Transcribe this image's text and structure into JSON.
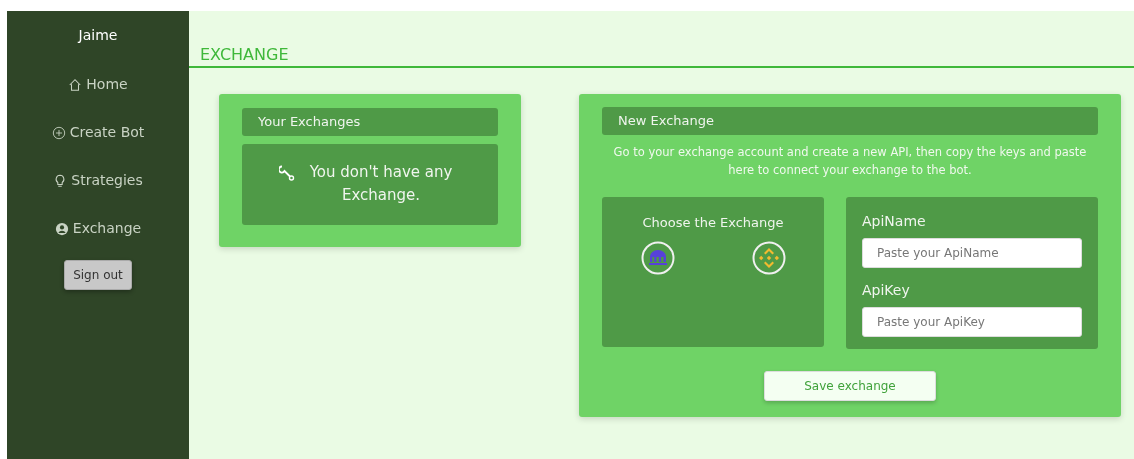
{
  "sidebar": {
    "user": "Jaime",
    "items": [
      {
        "label": "Home"
      },
      {
        "label": "Create Bot"
      },
      {
        "label": "Strategies"
      },
      {
        "label": "Exchange"
      }
    ],
    "sign_out": "Sign out"
  },
  "page_title": "EXCHANGE",
  "your_exchanges": {
    "title": "Your Exchanges",
    "empty_message": "You don't have any Exchange."
  },
  "new_exchange": {
    "title": "New Exchange",
    "instructions": "Go to your exchange account and create a new API, then copy the keys and paste here to connect your exchange to the bot.",
    "choose_title": "Choose the Exchange",
    "exchanges": [
      {
        "kind": "kraken"
      },
      {
        "kind": "binance"
      }
    ],
    "fields": [
      {
        "label": "ApiName",
        "placeholder": "Paste your ApiName"
      },
      {
        "label": "ApiKey",
        "placeholder": "Paste your ApiKey"
      }
    ],
    "save_button": "Save exchange"
  }
}
